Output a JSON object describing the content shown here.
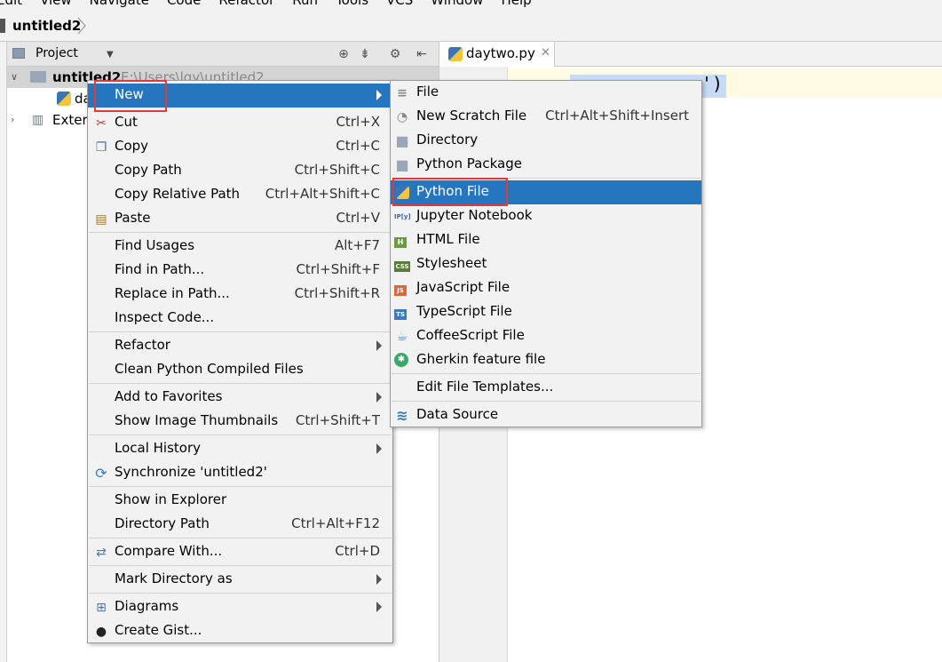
{
  "menubar": {
    "items": [
      "Edit",
      "View",
      "Navigate",
      "Code",
      "Refactor",
      "Run",
      "Tools",
      "VCS",
      "Window",
      "Help"
    ]
  },
  "navbar": {
    "crumb": "untitled2"
  },
  "project": {
    "title": "Project",
    "root_name": "untitled2",
    "root_path": "E:\\Users\\lgy\\untitled2",
    "file_partial": "da",
    "external_partial": "Extern"
  },
  "editor": {
    "tab_label": "daytwo.py",
    "code_visible": "')"
  },
  "context_menu": {
    "items": [
      {
        "label": "New",
        "shortcut": "",
        "submenu": true
      },
      {
        "label": "Cut",
        "shortcut": "Ctrl+X"
      },
      {
        "label": "Copy",
        "shortcut": "Ctrl+C"
      },
      {
        "label": "Copy Path",
        "shortcut": "Ctrl+Shift+C"
      },
      {
        "label": "Copy Relative Path",
        "shortcut": "Ctrl+Alt+Shift+C"
      },
      {
        "label": "Paste",
        "shortcut": "Ctrl+V"
      },
      {
        "label": "Find Usages",
        "shortcut": "Alt+F7"
      },
      {
        "label": "Find in Path...",
        "shortcut": "Ctrl+Shift+F"
      },
      {
        "label": "Replace in Path...",
        "shortcut": "Ctrl+Shift+R"
      },
      {
        "label": "Inspect Code...",
        "shortcut": ""
      },
      {
        "label": "Refactor",
        "shortcut": "",
        "submenu": true
      },
      {
        "label": "Clean Python Compiled Files",
        "shortcut": ""
      },
      {
        "label": "Add to Favorites",
        "shortcut": "",
        "submenu": true
      },
      {
        "label": "Show Image Thumbnails",
        "shortcut": "Ctrl+Shift+T"
      },
      {
        "label": "Local History",
        "shortcut": "",
        "submenu": true
      },
      {
        "label": "Synchronize 'untitled2'",
        "shortcut": ""
      },
      {
        "label": "Show in Explorer",
        "shortcut": ""
      },
      {
        "label": "Directory Path",
        "shortcut": "Ctrl+Alt+F12"
      },
      {
        "label": "Compare With...",
        "shortcut": "Ctrl+D"
      },
      {
        "label": "Mark Directory as",
        "shortcut": "",
        "submenu": true
      },
      {
        "label": "Diagrams",
        "shortcut": "",
        "submenu": true
      },
      {
        "label": "Create Gist...",
        "shortcut": ""
      }
    ]
  },
  "new_submenu": {
    "items": [
      {
        "label": "File",
        "shortcut": ""
      },
      {
        "label": "New Scratch File",
        "shortcut": "Ctrl+Alt+Shift+Insert"
      },
      {
        "label": "Directory",
        "shortcut": ""
      },
      {
        "label": "Python Package",
        "shortcut": ""
      },
      {
        "label": "Python File",
        "shortcut": ""
      },
      {
        "label": "Jupyter Notebook",
        "shortcut": ""
      },
      {
        "label": "HTML File",
        "shortcut": ""
      },
      {
        "label": "Stylesheet",
        "shortcut": ""
      },
      {
        "label": "JavaScript File",
        "shortcut": ""
      },
      {
        "label": "TypeScript File",
        "shortcut": ""
      },
      {
        "label": "CoffeeScript File",
        "shortcut": ""
      },
      {
        "label": "Gherkin feature file",
        "shortcut": ""
      },
      {
        "label": "Edit File Templates...",
        "shortcut": ""
      },
      {
        "label": "Data Source",
        "shortcut": ""
      }
    ]
  },
  "icon_labels": {
    "jupyter": "IP[y]",
    "html": "H",
    "css": "CSS",
    "js": "JS",
    "ts": "TS"
  },
  "colors": {
    "selection": "#2675bf",
    "highlight_box": "#e0393e"
  }
}
